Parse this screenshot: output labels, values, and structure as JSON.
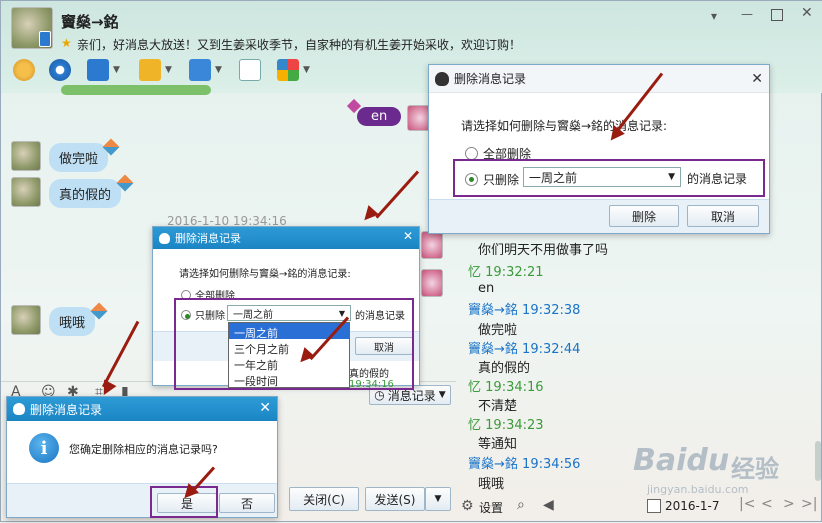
{
  "chat": {
    "contact_name": "竇燊→銘",
    "status_text": "亲们，好消息大放送！又到生姜采收季节，自家种的有机生姜开始采收，欢迎订购！",
    "messages": [
      {
        "text": "en",
        "side": "right"
      },
      {
        "text": "做完啦",
        "side": "left"
      },
      {
        "text": "真的假的",
        "side": "left"
      },
      {
        "text": "哦哦",
        "side": "left"
      }
    ],
    "timestamp_divider": "2016-1-10 19:34:16",
    "close_button": "关闭(C)",
    "send_button": "发送(S)",
    "msg_record_button": "消息记录"
  },
  "history": {
    "lines": [
      {
        "kind": "text",
        "text": "你们明天不用做事了吗"
      },
      {
        "kind": "meta",
        "who": "忆",
        "time": "19:32:21",
        "color": "green"
      },
      {
        "kind": "text",
        "text": "en"
      },
      {
        "kind": "meta",
        "who": "竇燊→銘",
        "time": "19:32:38",
        "color": "blue"
      },
      {
        "kind": "text",
        "text": "做完啦"
      },
      {
        "kind": "meta",
        "who": "竇燊→銘",
        "time": "19:32:44",
        "color": "blue"
      },
      {
        "kind": "text",
        "text": "真的假的"
      },
      {
        "kind": "meta",
        "who": "忆",
        "time": "19:34:16",
        "color": "green"
      },
      {
        "kind": "text",
        "text": "不清楚"
      },
      {
        "kind": "meta",
        "who": "忆",
        "time": "19:34:23",
        "color": "green"
      },
      {
        "kind": "text",
        "text": "等通知"
      },
      {
        "kind": "meta",
        "who": "竇燊→銘",
        "time": "19:34:56",
        "color": "blue"
      },
      {
        "kind": "text",
        "text": "哦哦"
      }
    ],
    "settings_label": "设置",
    "date": "2016-1-7"
  },
  "dialog_large": {
    "title": "删除消息记录",
    "prompt": "请选择如何删除与竇燊→銘的消息记录:",
    "option_all": "全部删除",
    "option_only": "只删除",
    "selected_range": "一周之前",
    "suffix": "的消息记录",
    "delete_button": "删除",
    "cancel_button": "取消"
  },
  "dialog_small": {
    "title": "删除消息记录",
    "prompt": "请选择如何删除与竇燊→銘的消息记录:",
    "option_all": "全部删除",
    "option_only": "只删除",
    "selected_range": "一周之前",
    "suffix": "的消息记录",
    "cancel_button": "取消",
    "dropdown_options": [
      "一周之前",
      "三个月之前",
      "一年之前",
      "一段时间"
    ],
    "behind_text_1": "真的假的",
    "behind_text_2": "19:34:16"
  },
  "dialog_confirm": {
    "title": "删除消息记录",
    "message": "您确定删除相应的消息记录吗?",
    "yes_button": "是",
    "no_button": "否"
  },
  "watermark": {
    "brand": "Baidu",
    "suffix": "经验",
    "url": "jingyan.baidu.com"
  },
  "colors": {
    "title_blue": "#1b85c4",
    "highlight_purple": "#7a2a8e",
    "arrow_red": "#9a1c10",
    "meta_blue": "#1a73c8",
    "meta_green": "#3a9a3a"
  }
}
